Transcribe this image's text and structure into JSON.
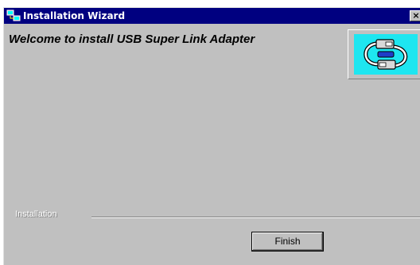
{
  "window": {
    "title": "Installation  Wizard",
    "close_label": "×"
  },
  "main": {
    "welcome_text": "Welcome to install USB Super Link Adapter",
    "logo_icon": "usb-link-icon",
    "group_label": "Installation",
    "finish_label": "Finish"
  },
  "colors": {
    "titlebar": "#000080",
    "window_bg": "#c0c0c0",
    "logo_bg": "#1ee6f0"
  }
}
